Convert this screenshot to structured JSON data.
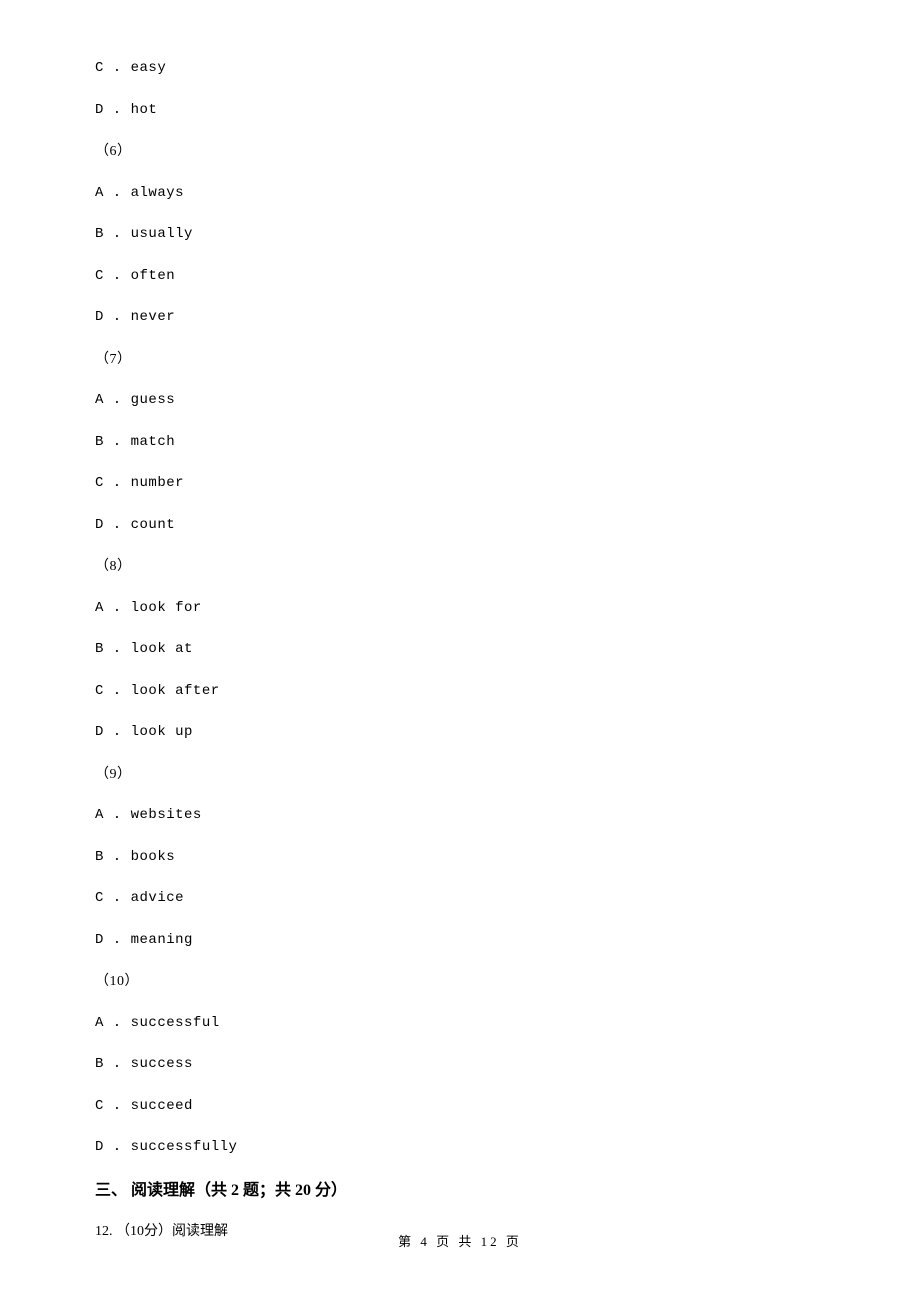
{
  "q5_remaining": [
    {
      "label": "C",
      "text": "easy"
    },
    {
      "label": "D",
      "text": "hot"
    }
  ],
  "groups": [
    {
      "num": "（6）",
      "opts": [
        {
          "label": "A",
          "text": "always"
        },
        {
          "label": "B",
          "text": "usually"
        },
        {
          "label": "C",
          "text": "often"
        },
        {
          "label": "D",
          "text": "never"
        }
      ]
    },
    {
      "num": "（7）",
      "opts": [
        {
          "label": "A",
          "text": "guess"
        },
        {
          "label": "B",
          "text": "match"
        },
        {
          "label": "C",
          "text": "number"
        },
        {
          "label": "D",
          "text": "count"
        }
      ]
    },
    {
      "num": "（8）",
      "opts": [
        {
          "label": "A",
          "text": "look for"
        },
        {
          "label": "B",
          "text": "look at"
        },
        {
          "label": "C",
          "text": "look after"
        },
        {
          "label": "D",
          "text": "look up"
        }
      ]
    },
    {
      "num": "（9）",
      "opts": [
        {
          "label": "A",
          "text": "websites"
        },
        {
          "label": "B",
          "text": "books"
        },
        {
          "label": "C",
          "text": "advice"
        },
        {
          "label": "D",
          "text": "meaning"
        }
      ]
    },
    {
      "num": "（10）",
      "opts": [
        {
          "label": "A",
          "text": "successful"
        },
        {
          "label": "B",
          "text": "success"
        },
        {
          "label": "C",
          "text": "succeed"
        },
        {
          "label": "D",
          "text": "successfully"
        }
      ]
    }
  ],
  "section_heading": "三、 阅读理解（共 2 题；共 20 分）",
  "q12": "12. （10分）阅读理解",
  "footer": "第 4 页 共 12 页"
}
